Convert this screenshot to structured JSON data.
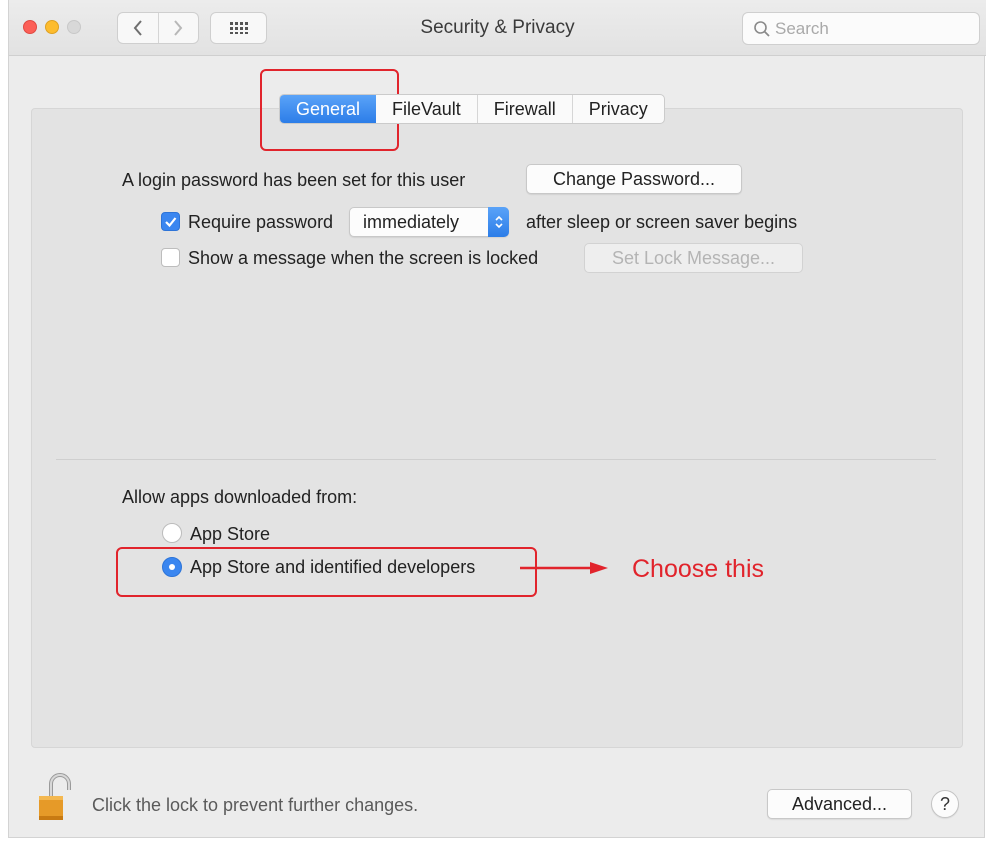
{
  "window": {
    "title": "Security & Privacy",
    "search_placeholder": "Search"
  },
  "tabs": [
    {
      "label": "General",
      "active": true
    },
    {
      "label": "FileVault",
      "active": false
    },
    {
      "label": "Firewall",
      "active": false
    },
    {
      "label": "Privacy",
      "active": false
    }
  ],
  "general": {
    "login_password_text": "A login password has been set for this user",
    "change_password_label": "Change Password...",
    "require_password": {
      "checked": true,
      "label": "Require password",
      "select_value": "immediately",
      "suffix": "after sleep or screen saver begins"
    },
    "show_message": {
      "checked": false,
      "label": "Show a message when the screen is locked",
      "button_label": "Set Lock Message..."
    },
    "allow_apps_label": "Allow apps downloaded from:",
    "allow_options": [
      {
        "label": "App Store",
        "selected": false
      },
      {
        "label": "App Store and identified developers",
        "selected": true
      }
    ]
  },
  "annotation": {
    "text": "Choose this",
    "color": "#e1242c"
  },
  "footer": {
    "lock_text": "Click the lock to prevent further changes.",
    "advanced_label": "Advanced...",
    "help_label": "?"
  },
  "colors": {
    "accent": "#2c7de8",
    "close": "#fc5f57",
    "minimize": "#fdbc2e"
  }
}
